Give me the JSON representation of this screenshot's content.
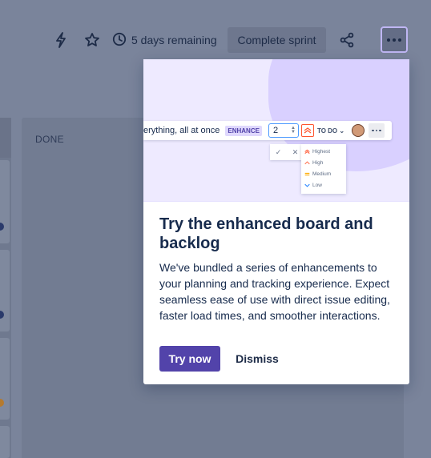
{
  "toolbar": {
    "automation_icon": "lightning-icon",
    "star_icon": "star-icon",
    "clock_icon": "clock-icon",
    "remaining_text": "5 days remaining",
    "complete_sprint_label": "Complete sprint",
    "share_icon": "share-icon",
    "more_icon": "more-dots-icon"
  },
  "board": {
    "done_column_title": "DONE"
  },
  "popup": {
    "illustration": {
      "issue_text": "erything, all at once",
      "enhance_tag": "ENHANCE",
      "story_points": "2",
      "status": "TO DO",
      "priority_options": [
        "Highest",
        "High",
        "Medium",
        "Low"
      ]
    },
    "title": "Try the enhanced board and backlog",
    "body": "We've bundled a series of enhancements to your planning and tracking experience. Expect seamless ease of use with direct issue editing, faster load times, and smoother interactions.",
    "primary_button": "Try now",
    "secondary_button": "Dismiss"
  },
  "colors": {
    "primary": "#5243aa",
    "overlay": "#7a849b",
    "hero_bg": "#eeeaff"
  }
}
